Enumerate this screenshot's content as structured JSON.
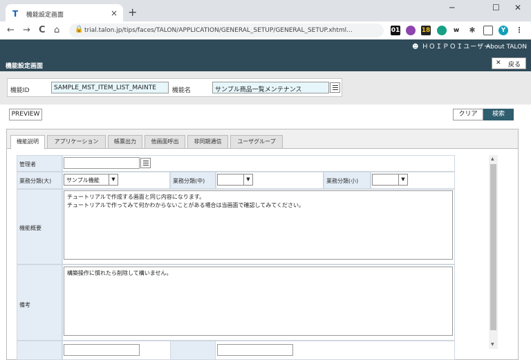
{
  "browser": {
    "tab_title": "機能設定画面",
    "tab_close": "×",
    "new_tab": "+",
    "favicon": "T",
    "url": "trial.talon.jp/tips/faces/TALON/APPLICATION/GENERAL_SETUP/GENERAL_SETUP.xhtml...",
    "nav_back": "←",
    "nav_forward": "→",
    "reload": "C",
    "home": "⌂",
    "lock": "🔒",
    "ext_01": "01",
    "ext_18": "18",
    "ext_w": "w",
    "avatar": "Y",
    "window_minimize": "─",
    "window_maximize": "☐",
    "window_close": "✕"
  },
  "header": {
    "user": "ＨＯＩＰＯＩユーザー",
    "about": "About TALON",
    "page_title": "機能設定画面",
    "back_label": "戻る",
    "back_icon": "✕"
  },
  "search": {
    "function_id_label": "機能ID",
    "function_id_value": "SAMPLE_MST_ITEM_LIST_MAINTE",
    "function_name_label": "機能名",
    "function_name_value": "サンプル商品一覧メンテナンス"
  },
  "actions": {
    "preview": "PREVIEW",
    "clear": "クリア",
    "search": "検索"
  },
  "tabs": [
    {
      "label": "機能説明",
      "active": true
    },
    {
      "label": "アプリケーション",
      "active": false
    },
    {
      "label": "帳票出力",
      "active": false
    },
    {
      "label": "他画面呼出",
      "active": false
    },
    {
      "label": "非同期通信",
      "active": false
    },
    {
      "label": "ユーザグループ",
      "active": false
    }
  ],
  "form": {
    "manager_label": "管理者",
    "manager_value": "",
    "cat_large_label": "業務分類(大)",
    "cat_large_value": "サンプル機能",
    "cat_mid_label": "業務分類(中)",
    "cat_mid_value": "",
    "cat_small_label": "業務分類(小)",
    "cat_small_value": "",
    "summary_label": "機能概要",
    "summary_value": "チュートリアルで作成する画面と同じ内容になります。\nチュートリアルで作ってみて何かわからないことがある場合は当画面で確認してみてください。",
    "remarks_label": "備考",
    "remarks_value": "構築操作に慣れたら削除して構いません。",
    "dropdown_arrow": "▼"
  },
  "colors": {
    "header_bg": "#2f4a58",
    "accent": "#2f5e6f",
    "input_bg": "#e6f6fb",
    "label_cell": "#e4edf6"
  }
}
